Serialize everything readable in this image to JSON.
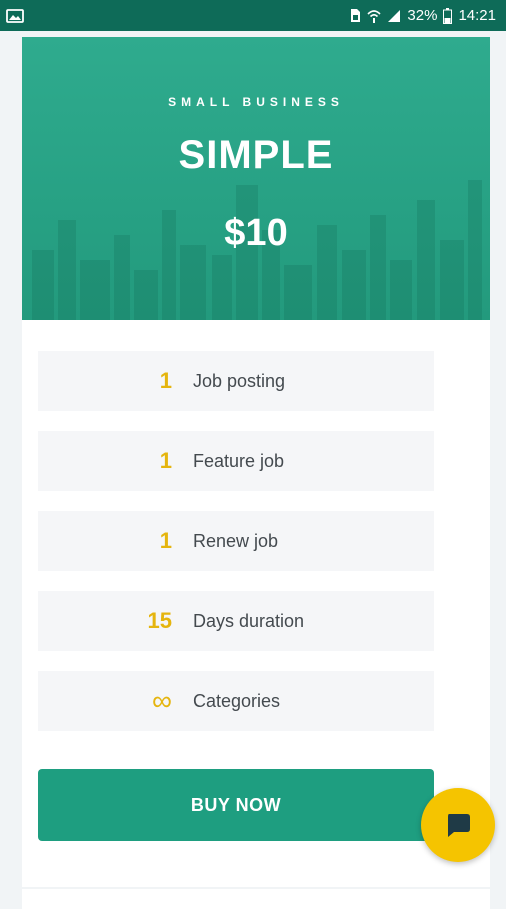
{
  "status_bar": {
    "battery": "32%",
    "time": "14:21",
    "icons": [
      "image-notification-icon",
      "sim-card-icon",
      "wifi-icon",
      "signal-icon",
      "battery-icon"
    ]
  },
  "plan": {
    "subtitle": "SMALL BUSINESS",
    "name": "SIMPLE",
    "price": "$10"
  },
  "features": [
    {
      "value": "1",
      "label": "Job posting"
    },
    {
      "value": "1",
      "label": "Feature job"
    },
    {
      "value": "1",
      "label": "Renew job"
    },
    {
      "value": "15",
      "label": "Days duration"
    },
    {
      "value": "∞",
      "label": "Categories"
    }
  ],
  "buy_button": {
    "label": "BUY NOW"
  },
  "chat_button": {
    "icon": "chat-bubble-icon"
  },
  "colors": {
    "status_bar": "#0e6b58",
    "hero": "#27a184",
    "accent_value": "#e5b50f",
    "button": "#1e9e80",
    "fab": "#f5c400",
    "feature_bg": "#f5f6f8"
  }
}
